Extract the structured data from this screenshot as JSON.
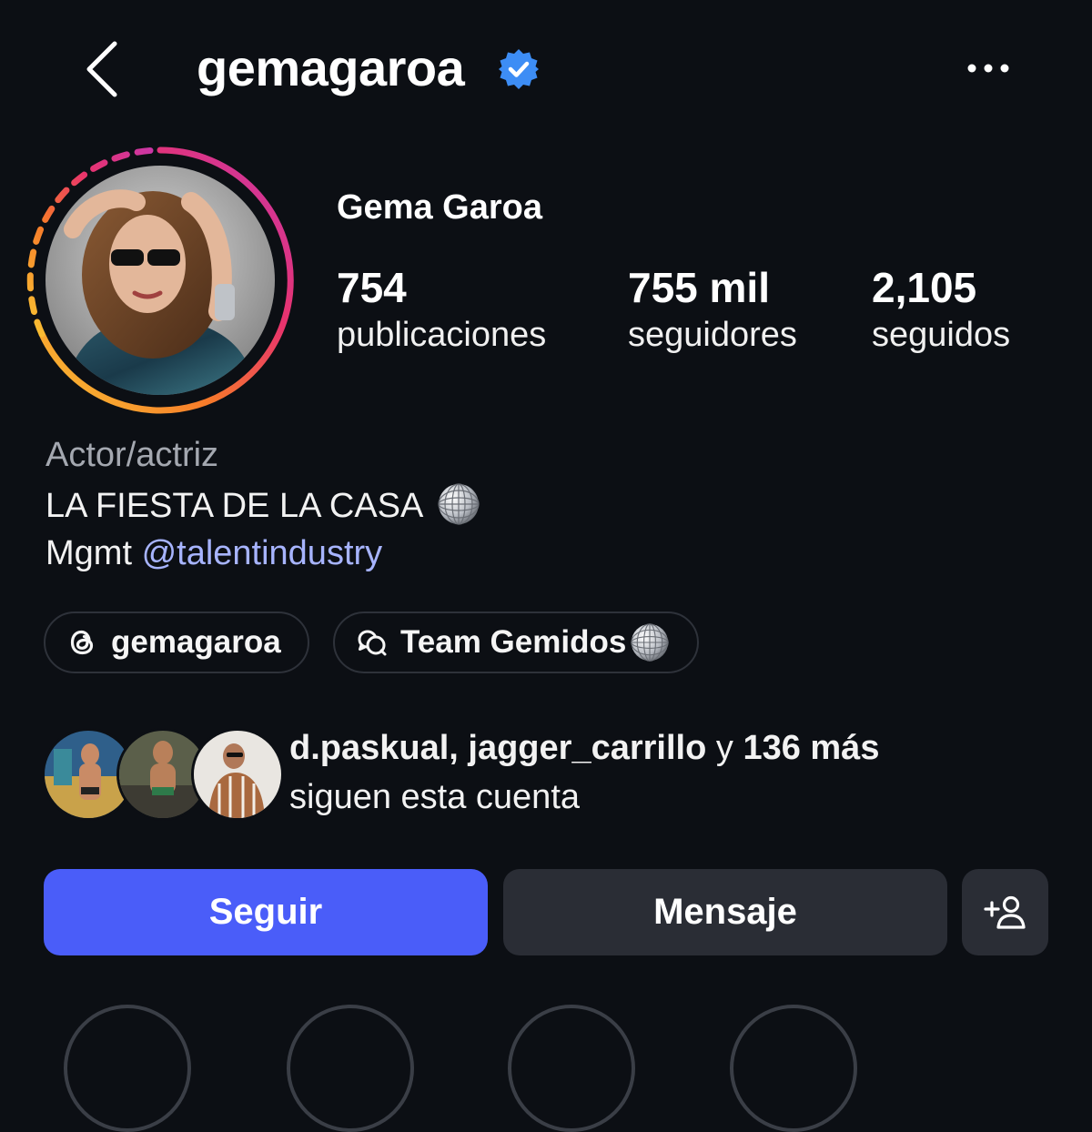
{
  "header": {
    "username": "gemagaroa",
    "verified": true,
    "back_icon": "chevron-left-icon",
    "more_icon": "more-horizontal-icon"
  },
  "profile": {
    "full_name": "Gema Garoa",
    "stats": [
      {
        "value": "754",
        "label": "publicaciones"
      },
      {
        "value": "755 mil",
        "label": "seguidores"
      },
      {
        "value": "2,105",
        "label": "seguidos"
      }
    ],
    "category": "Actor/actriz",
    "bio_line1": "LA FIESTA DE LA CASA",
    "bio_line2_prefix": "Mgmt",
    "bio_line2_mention": "@talentindustry"
  },
  "chips": [
    {
      "icon": "threads-icon",
      "label": "gemagaroa"
    },
    {
      "icon": "chat-bubbles-icon",
      "label": "Team Gemidos"
    }
  ],
  "followed_by": {
    "names": "d.paskual, jagger_carrillo",
    "connector": "y",
    "more": "136 más",
    "suffix": "siguen esta cuenta"
  },
  "actions": {
    "follow_label": "Seguir",
    "message_label": "Mensaje",
    "add_user_icon": "add-person-icon"
  },
  "colors": {
    "background": "#0c0f14",
    "follow_button": "#4a5df9",
    "secondary_button": "#2a2d35",
    "mention": "#a7b4ff",
    "verified_badge": "#3d8df5"
  }
}
